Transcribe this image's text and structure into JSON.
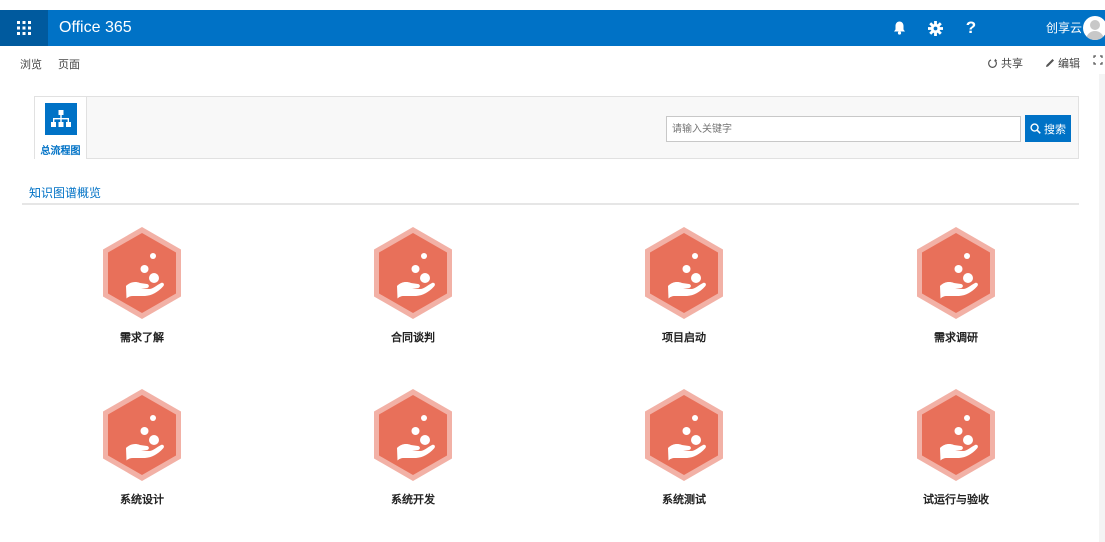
{
  "suitebar": {
    "brand": "Office 365",
    "username": "创享云",
    "icons": [
      "waffle-icon",
      "bell-icon",
      "gear-icon",
      "help-icon",
      "avatar"
    ],
    "help_label": "?"
  },
  "ribbon": {
    "tabs": [
      "浏览",
      "页面"
    ],
    "share_label": "共享",
    "edit_label": "编辑"
  },
  "toppanel": {
    "tile_label": "总流程图",
    "search_placeholder": "请输入关键字",
    "search_button_label": "搜索"
  },
  "section": {
    "tab_label": "知识图谱概览"
  },
  "items": [
    {
      "label": "需求了解"
    },
    {
      "label": "合同谈判"
    },
    {
      "label": "项目启动"
    },
    {
      "label": "需求调研"
    },
    {
      "label": "系统设计"
    },
    {
      "label": "系统开发"
    },
    {
      "label": "系统测试"
    },
    {
      "label": "试运行与验收"
    }
  ],
  "colors": {
    "brand_blue": "#0072c6",
    "waffle_bg": "#005a9e",
    "hex_fill": "#e8705a",
    "hex_border": "#f2b1a6"
  }
}
